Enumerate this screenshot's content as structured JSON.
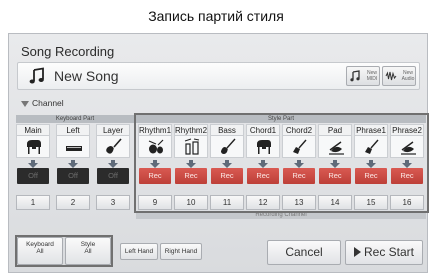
{
  "caption": "Запись партий стиля",
  "window": {
    "title": "Song Recording"
  },
  "song": {
    "name": "New Song",
    "new_midi_label": "New\nMIDI",
    "new_audio_label": "New\nAudio"
  },
  "channel_section": {
    "label": "Channel"
  },
  "keyboard_part": {
    "header": "Keyboard Part",
    "parts": [
      {
        "name": "Main",
        "icon": "grand-piano-icon",
        "status": "Off",
        "channel": "1"
      },
      {
        "name": "Left",
        "icon": "keyboard-icon",
        "status": "Off",
        "channel": "2"
      },
      {
        "name": "Layer",
        "icon": "guitar-icon",
        "status": "Off",
        "channel": "3"
      }
    ]
  },
  "style_part": {
    "header": "Style Part",
    "parts": [
      {
        "name": "Rhythm1",
        "icon": "drum-kit-icon",
        "status": "Rec",
        "channel": "9"
      },
      {
        "name": "Rhythm2",
        "icon": "percussion-icon",
        "status": "Rec",
        "channel": "10"
      },
      {
        "name": "Bass",
        "icon": "bass-guitar-icon",
        "status": "Rec",
        "channel": "11"
      },
      {
        "name": "Chord1",
        "icon": "grand-piano-icon",
        "status": "Rec",
        "channel": "12"
      },
      {
        "name": "Chord2",
        "icon": "electric-guitar-icon",
        "status": "Rec",
        "channel": "13"
      },
      {
        "name": "Pad",
        "icon": "strings-icon",
        "status": "Rec",
        "channel": "14"
      },
      {
        "name": "Phrase1",
        "icon": "electric-guitar-icon",
        "status": "Rec",
        "channel": "15"
      },
      {
        "name": "Phrase2",
        "icon": "strings-icon",
        "status": "Rec",
        "channel": "16"
      }
    ]
  },
  "recording_channel": {
    "label": "Recording Channel"
  },
  "bottom_bar": {
    "keyboard_all": {
      "line1": "Keyboard",
      "line2": "All"
    },
    "style_all": {
      "line1": "Style",
      "line2": "All"
    },
    "left_hand": "Left Hand",
    "right_hand": "Right Hand",
    "cancel": "Cancel",
    "rec_start": "Rec Start"
  },
  "colors": {
    "rec": "#c9473f",
    "off": "#2b2b2b",
    "highlight": "#707070"
  }
}
